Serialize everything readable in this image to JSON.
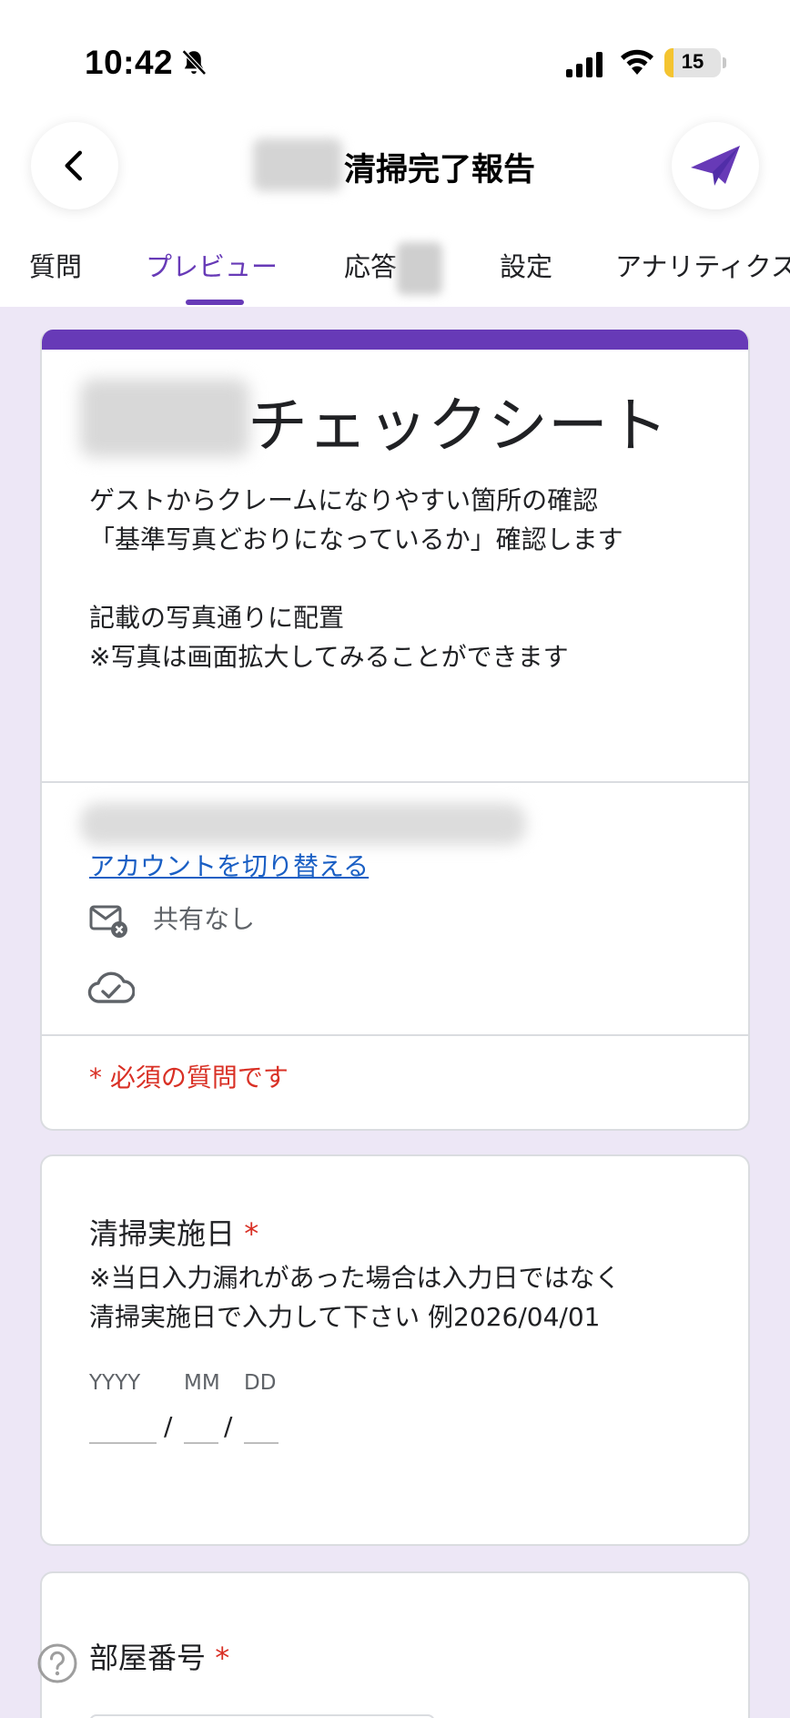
{
  "status_bar": {
    "time": "10:42",
    "battery": "15",
    "battery_color": "#f4c430"
  },
  "header": {
    "title": "清掃完了報告",
    "back_icon": "chevron-left-icon",
    "send_icon": "paper-plane-icon",
    "accent_color": "#673ab7"
  },
  "tabs": [
    {
      "label": "質問"
    },
    {
      "label": "プレビュー",
      "active": true
    },
    {
      "label": "応答"
    },
    {
      "label": "設定"
    },
    {
      "label": "アナリティクス"
    }
  ],
  "form": {
    "title": "チェックシート",
    "description_lines": [
      "ゲストからクレームになりやすい箇所の確認",
      "「基準写真どおりになっているか」確認します",
      "",
      "記載の写真通りに配置",
      "※写真は画面拡大してみることができます"
    ],
    "switch_account": "アカウントを切り替える",
    "not_shared": "共有なし",
    "required_note": "* 必須の質問です"
  },
  "questions": [
    {
      "title": "清掃実施日",
      "required_mark": "*",
      "description_lines": [
        "※当日入力漏れがあった場合は入力日ではなく",
        "清掃実施日で入力して下さい 例2026/04/01"
      ],
      "date_labels": [
        "YYYY",
        "MM",
        "DD"
      ],
      "separator": "/"
    },
    {
      "title": "部屋番号",
      "required_mark": "*"
    }
  ]
}
